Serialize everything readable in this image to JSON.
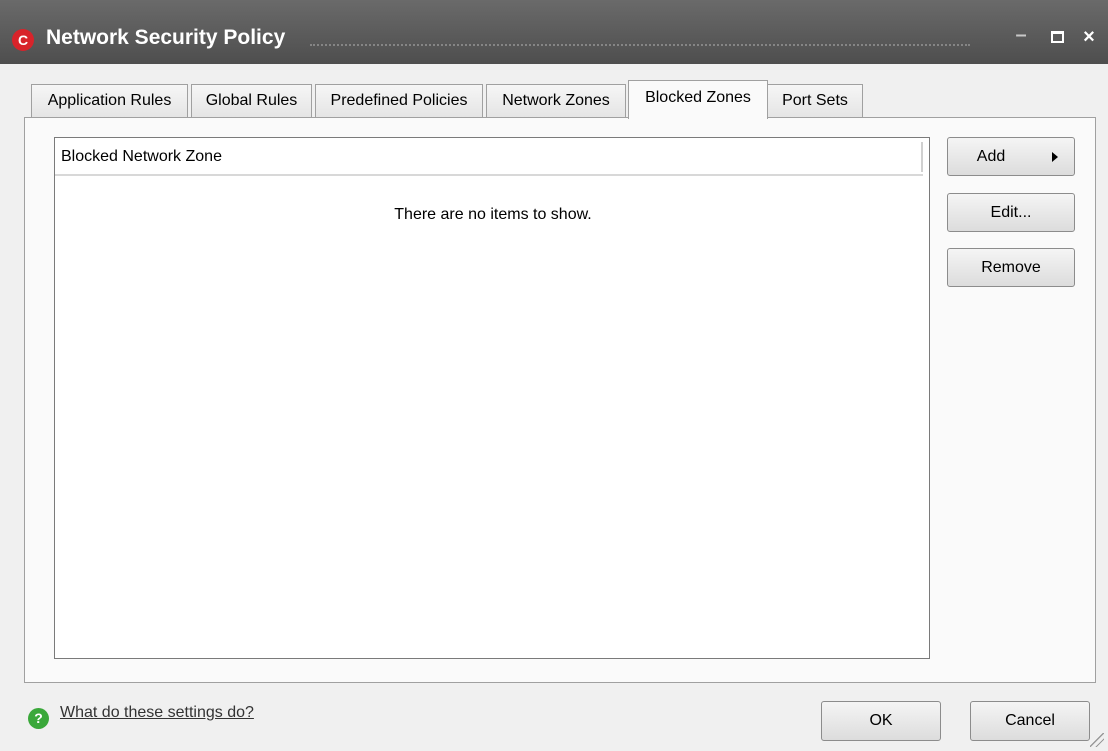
{
  "window": {
    "title": "Network Security Policy",
    "app_icon_glyph": "C",
    "controls": {
      "minimize": "–",
      "close": "×"
    }
  },
  "tabs": [
    {
      "label": "Application Rules",
      "active": false
    },
    {
      "label": "Global Rules",
      "active": false
    },
    {
      "label": "Predefined Policies",
      "active": false
    },
    {
      "label": "Network Zones",
      "active": false
    },
    {
      "label": "Blocked Zones",
      "active": true
    },
    {
      "label": "Port Sets",
      "active": false
    }
  ],
  "list": {
    "column_header": "Blocked Network Zone",
    "empty_message": "There are no items to show."
  },
  "actions": {
    "add": "Add",
    "edit": "Edit...",
    "remove": "Remove"
  },
  "footer": {
    "help_icon_glyph": "?",
    "help_link": "What do these settings do?",
    "ok": "OK",
    "cancel": "Cancel"
  },
  "colors": {
    "titlebar": "#555555",
    "app_icon": "#d8232a",
    "help_icon": "#3aa83a"
  }
}
